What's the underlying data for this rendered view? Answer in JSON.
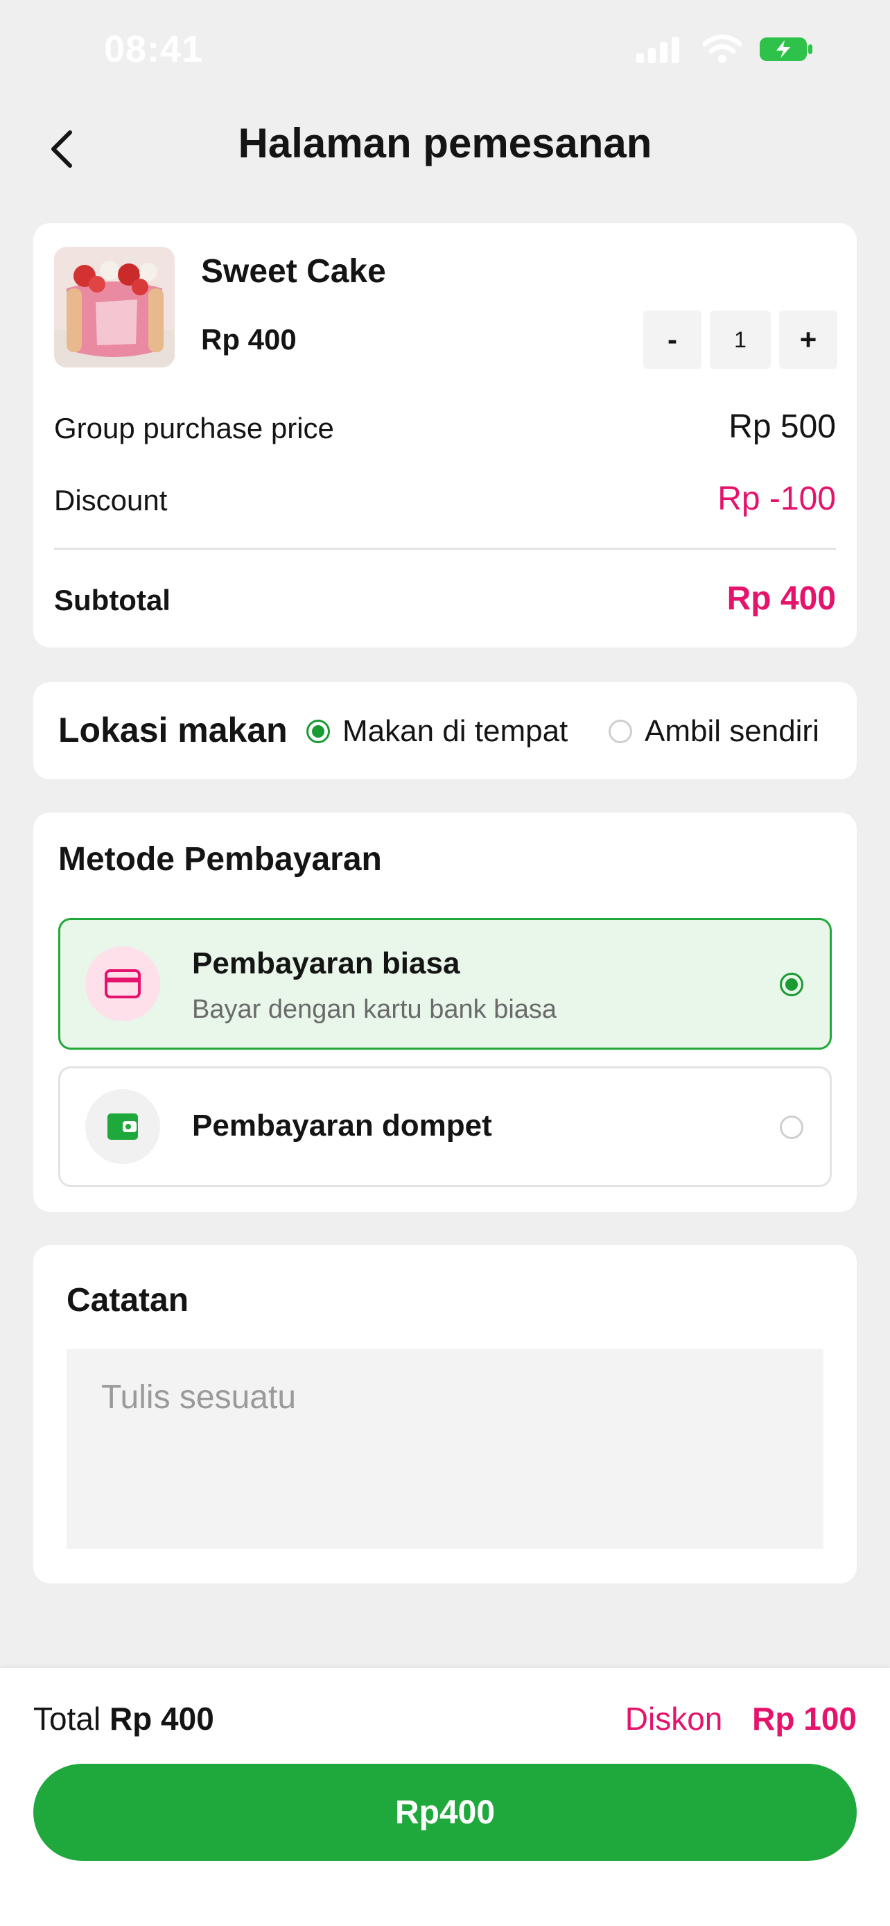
{
  "status_bar": {
    "time": "08:41"
  },
  "header": {
    "title": "Halaman pemesanan",
    "back_icon": "chevron-left-icon"
  },
  "product": {
    "name": "Sweet Cake",
    "price": "Rp 400",
    "quantity": "1",
    "minus_label": "-",
    "plus_label": "+",
    "group_price_label": "Group purchase price",
    "group_price_value": "Rp 500",
    "discount_label": "Discount",
    "discount_value": "Rp -100",
    "subtotal_label": "Subtotal",
    "subtotal_value": "Rp 400"
  },
  "location": {
    "title": "Lokasi makan",
    "options": [
      {
        "label": "Makan di tempat",
        "selected": true
      },
      {
        "label": "Ambil sendiri",
        "selected": false
      }
    ]
  },
  "payment": {
    "title": "Metode Pembayaran",
    "options": [
      {
        "name": "Pembayaran biasa",
        "description": "Bayar dengan kartu bank biasa",
        "icon": "credit-card-icon",
        "selected": true
      },
      {
        "name": "Pembayaran dompet",
        "icon": "wallet-icon",
        "selected": false
      }
    ]
  },
  "notes": {
    "title": "Catatan",
    "placeholder": "Tulis sesuatu"
  },
  "footer": {
    "total_label": "Total",
    "total_value": "Rp 400",
    "discount_label": "Diskon",
    "discount_value": "Rp 100",
    "pay_button": "Rp400"
  },
  "colors": {
    "accent_green": "#1fa83b",
    "accent_pink": "#e5136b",
    "background": "#efefef"
  }
}
